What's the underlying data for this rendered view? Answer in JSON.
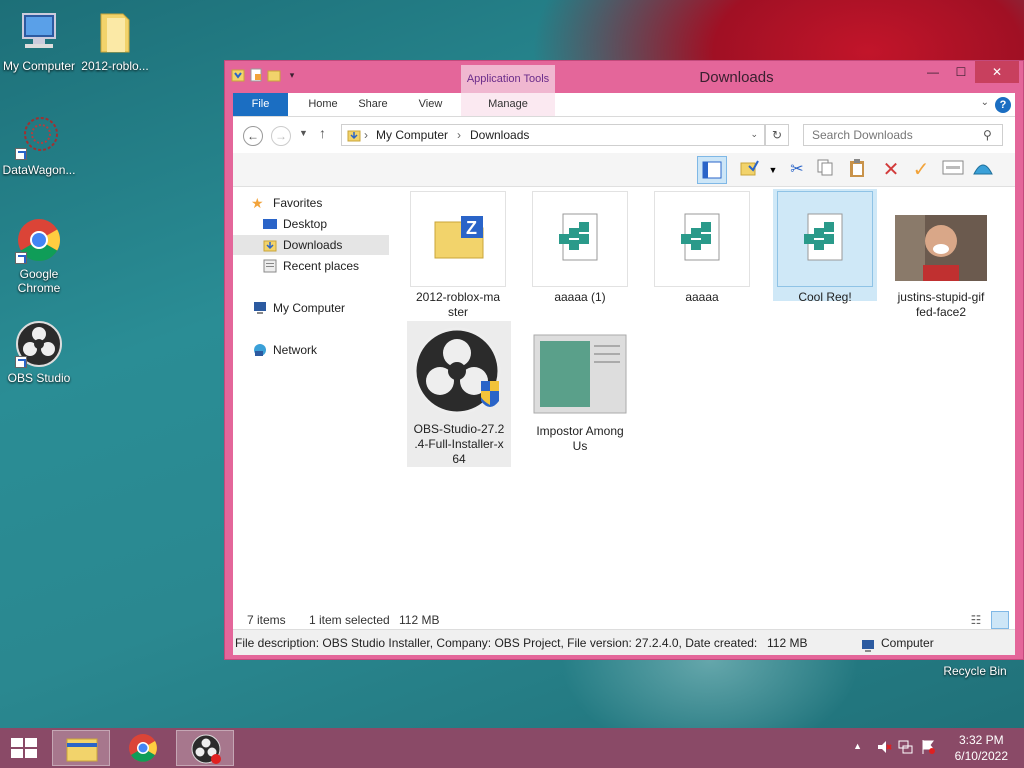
{
  "desktop": {
    "icons": [
      {
        "label": "My Computer",
        "icon": "computer-icon"
      },
      {
        "label": "2012-roblo...",
        "icon": "folder-icon"
      },
      {
        "label": "DataWagon...",
        "icon": "datawagon-icon"
      },
      {
        "label": "Google Chrome",
        "icon": "chrome-icon"
      },
      {
        "label": "OBS Studio",
        "icon": "obs-icon"
      },
      {
        "label": "Recycle Bin",
        "icon": "recycle-bin-icon"
      }
    ]
  },
  "window": {
    "title": "Downloads",
    "context_tab": "Application Tools",
    "tabs": {
      "file": "File",
      "home": "Home",
      "share": "Share",
      "view": "View",
      "manage": "Manage"
    },
    "help": "?",
    "address": {
      "root": "My Computer",
      "current": "Downloads"
    },
    "search_placeholder": "Search Downloads",
    "nav": {
      "favorites": "Favorites",
      "desktop": "Desktop",
      "downloads": "Downloads",
      "recent": "Recent places",
      "computer": "My Computer",
      "network": "Network"
    },
    "files": [
      {
        "name": "2012-roblox-master",
        "line1": "2012-roblox-ma",
        "line2": "ster",
        "icon": "zip-folder-icon"
      },
      {
        "name": "aaaaa (1)",
        "line1": "aaaaa (1)",
        "line2": "",
        "icon": "registry-file-icon"
      },
      {
        "name": "aaaaa",
        "line1": "aaaaa",
        "line2": "",
        "icon": "registry-file-icon"
      },
      {
        "name": "Cool Reg!",
        "line1": "Cool Reg!",
        "line2": "",
        "icon": "registry-file-icon"
      },
      {
        "name": "justins-stupid-gif fed-face2",
        "line1": "justins-stupid-gif",
        "line2": "fed-face2",
        "icon": "photo-thumbnail"
      },
      {
        "name": "OBS-Studio-27.2.4-Full-Installer-x64",
        "line1": "OBS-Studio-27.2",
        "line2": ".4-Full-Installer-x",
        "line3": "64",
        "icon": "obs-installer-icon"
      },
      {
        "name": "Impostor Among Us",
        "line1": "Impostor Among",
        "line2": "Us",
        "icon": "app-window-icon"
      }
    ],
    "status": {
      "count": "7 items",
      "selected": "1 item selected",
      "size": "112 MB"
    },
    "details": {
      "text": "File description: OBS Studio Installer, Company: OBS Project, File version: 27.2.4.0, Date created:",
      "size": "112 MB",
      "location": "Computer"
    }
  },
  "taskbar": {
    "clock_time": "3:32 PM",
    "clock_date": "6/10/2022",
    "tray_arrow": "▲"
  },
  "colors": {
    "window_frame": "#e4669a",
    "taskbar": "#8a4a67",
    "accent": "#1b6ec2"
  }
}
